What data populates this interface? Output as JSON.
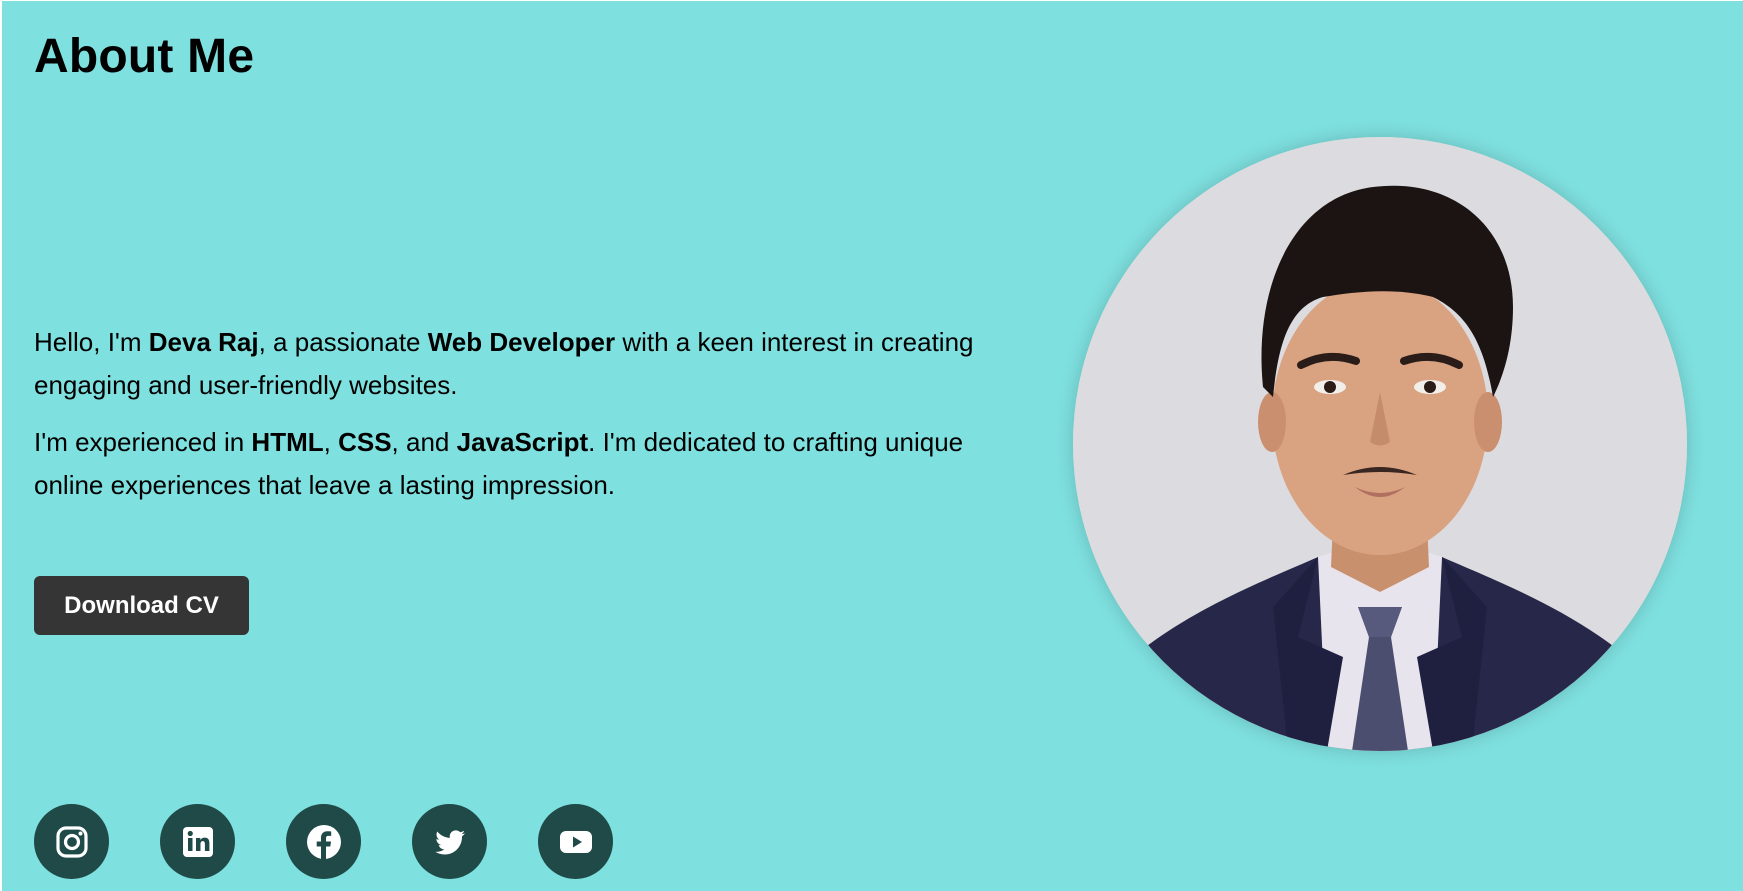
{
  "about": {
    "title": "About Me",
    "intro": {
      "t1": "Hello, I'm ",
      "name": "Deva Raj",
      "t2": ", a passionate ",
      "role": "Web Developer",
      "t3": " with a keen interest in creating engaging and user-friendly websites."
    },
    "skills": {
      "t1": "I'm experienced in ",
      "s1": "HTML",
      "t2": ", ",
      "s2": "CSS",
      "t3": ", and ",
      "s3": "JavaScript",
      "t4": ". I'm dedicated to crafting unique online experiences that leave a lasting impression."
    },
    "cv_button": "Download CV"
  },
  "socials": [
    {
      "icon": "instagram-icon"
    },
    {
      "icon": "linkedin-icon"
    },
    {
      "icon": "facebook-icon"
    },
    {
      "icon": "twitter-icon"
    },
    {
      "icon": "youtube-icon"
    }
  ],
  "colors": {
    "background": "#7ee0df",
    "button": "#353535",
    "social_bg": "#1f4a48"
  }
}
